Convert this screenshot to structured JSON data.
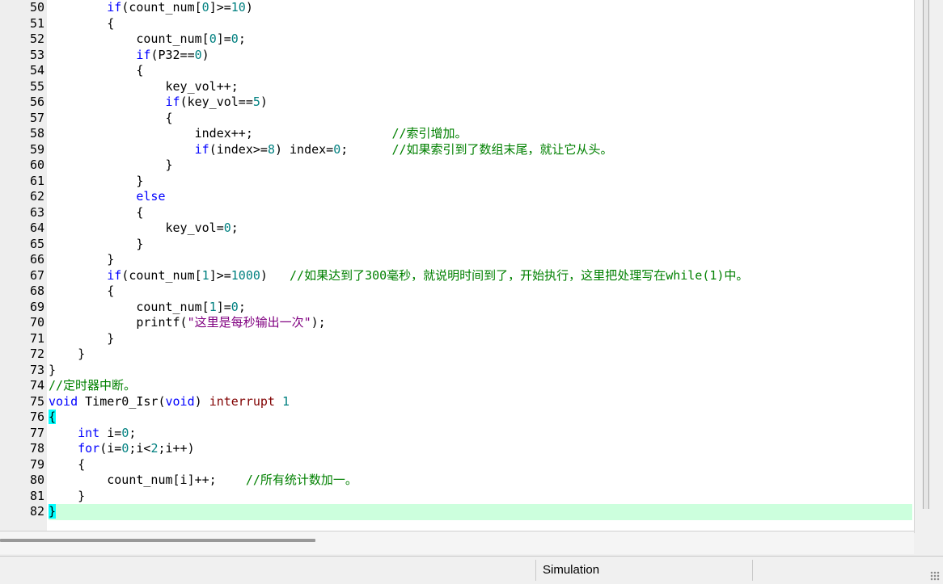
{
  "editor": {
    "lines": [
      {
        "n": "50",
        "parts": [
          {
            "t": "        "
          },
          {
            "t": "if",
            "c": "kw"
          },
          {
            "t": "(count_num["
          },
          {
            "t": "0",
            "c": "num"
          },
          {
            "t": "]>="
          },
          {
            "t": "10",
            "c": "num"
          },
          {
            "t": ")"
          }
        ]
      },
      {
        "n": "51",
        "parts": [
          {
            "t": "        {"
          }
        ]
      },
      {
        "n": "52",
        "parts": [
          {
            "t": "            count_num["
          },
          {
            "t": "0",
            "c": "num"
          },
          {
            "t": "]="
          },
          {
            "t": "0",
            "c": "num"
          },
          {
            "t": ";"
          }
        ]
      },
      {
        "n": "53",
        "parts": [
          {
            "t": "            "
          },
          {
            "t": "if",
            "c": "kw"
          },
          {
            "t": "(P32=="
          },
          {
            "t": "0",
            "c": "num"
          },
          {
            "t": ")"
          }
        ]
      },
      {
        "n": "54",
        "parts": [
          {
            "t": "            {"
          }
        ]
      },
      {
        "n": "55",
        "parts": [
          {
            "t": "                key_vol++;"
          }
        ]
      },
      {
        "n": "56",
        "parts": [
          {
            "t": "                "
          },
          {
            "t": "if",
            "c": "kw"
          },
          {
            "t": "(key_vol=="
          },
          {
            "t": "5",
            "c": "num"
          },
          {
            "t": ")"
          }
        ]
      },
      {
        "n": "57",
        "parts": [
          {
            "t": "                {"
          }
        ]
      },
      {
        "n": "58",
        "parts": [
          {
            "t": "                    index++;                   "
          },
          {
            "t": "//索引增加。",
            "c": "cmt"
          }
        ]
      },
      {
        "n": "59",
        "parts": [
          {
            "t": "                    "
          },
          {
            "t": "if",
            "c": "kw"
          },
          {
            "t": "(index>="
          },
          {
            "t": "8",
            "c": "num"
          },
          {
            "t": ") index="
          },
          {
            "t": "0",
            "c": "num"
          },
          {
            "t": ";      "
          },
          {
            "t": "//如果索引到了数组末尾，就让它从头。",
            "c": "cmt"
          }
        ]
      },
      {
        "n": "60",
        "parts": [
          {
            "t": "                }"
          }
        ]
      },
      {
        "n": "61",
        "parts": [
          {
            "t": "            }"
          }
        ]
      },
      {
        "n": "62",
        "parts": [
          {
            "t": "            "
          },
          {
            "t": "else",
            "c": "kw"
          }
        ]
      },
      {
        "n": "63",
        "parts": [
          {
            "t": "            {"
          }
        ]
      },
      {
        "n": "64",
        "parts": [
          {
            "t": "                key_vol="
          },
          {
            "t": "0",
            "c": "num"
          },
          {
            "t": ";"
          }
        ]
      },
      {
        "n": "65",
        "parts": [
          {
            "t": "            }"
          }
        ]
      },
      {
        "n": "66",
        "parts": [
          {
            "t": "        }"
          }
        ]
      },
      {
        "n": "67",
        "parts": [
          {
            "t": "        "
          },
          {
            "t": "if",
            "c": "kw"
          },
          {
            "t": "(count_num["
          },
          {
            "t": "1",
            "c": "num"
          },
          {
            "t": "]>="
          },
          {
            "t": "1000",
            "c": "num"
          },
          {
            "t": ")   "
          },
          {
            "t": "//如果达到了300毫秒，就说明时间到了，开始执行，这里把处理写在while(1)中。",
            "c": "cmt"
          }
        ]
      },
      {
        "n": "68",
        "parts": [
          {
            "t": "        {"
          }
        ]
      },
      {
        "n": "69",
        "parts": [
          {
            "t": "            count_num["
          },
          {
            "t": "1",
            "c": "num"
          },
          {
            "t": "]="
          },
          {
            "t": "0",
            "c": "num"
          },
          {
            "t": ";"
          }
        ]
      },
      {
        "n": "70",
        "parts": [
          {
            "t": "            printf("
          },
          {
            "t": "\"这里是每秒输出一次\"",
            "c": "str"
          },
          {
            "t": ");"
          }
        ]
      },
      {
        "n": "71",
        "parts": [
          {
            "t": "        }"
          }
        ]
      },
      {
        "n": "72",
        "parts": [
          {
            "t": "    }"
          }
        ]
      },
      {
        "n": "73",
        "parts": [
          {
            "t": "}"
          }
        ]
      },
      {
        "n": "74",
        "parts": [
          {
            "t": "//定时器中断。",
            "c": "cmt"
          }
        ]
      },
      {
        "n": "75",
        "parts": [
          {
            "t": "void",
            "c": "kw"
          },
          {
            "t": " Timer0_Isr("
          },
          {
            "t": "void",
            "c": "kw"
          },
          {
            "t": ") "
          },
          {
            "t": "interrupt",
            "c": "kw2"
          },
          {
            "t": " "
          },
          {
            "t": "1",
            "c": "num"
          }
        ]
      },
      {
        "n": "76",
        "parts": [
          {
            "t": "{",
            "c": "brace-hl"
          }
        ]
      },
      {
        "n": "77",
        "parts": [
          {
            "t": "    "
          },
          {
            "t": "int",
            "c": "kw"
          },
          {
            "t": " i="
          },
          {
            "t": "0",
            "c": "num"
          },
          {
            "t": ";"
          }
        ]
      },
      {
        "n": "78",
        "parts": [
          {
            "t": "    "
          },
          {
            "t": "for",
            "c": "kw"
          },
          {
            "t": "(i="
          },
          {
            "t": "0",
            "c": "num"
          },
          {
            "t": ";i<"
          },
          {
            "t": "2",
            "c": "num"
          },
          {
            "t": ";i++)"
          }
        ]
      },
      {
        "n": "79",
        "parts": [
          {
            "t": "    {"
          }
        ]
      },
      {
        "n": "80",
        "parts": [
          {
            "t": "        count_num[i]++;    "
          },
          {
            "t": "//所有统计数加一。",
            "c": "cmt"
          }
        ]
      },
      {
        "n": "81",
        "parts": [
          {
            "t": "    }"
          }
        ]
      },
      {
        "n": "82",
        "current": true,
        "parts": [
          {
            "t": "}",
            "c": "brace-hl"
          }
        ]
      }
    ]
  },
  "statusbar": {
    "mode": "Simulation"
  }
}
